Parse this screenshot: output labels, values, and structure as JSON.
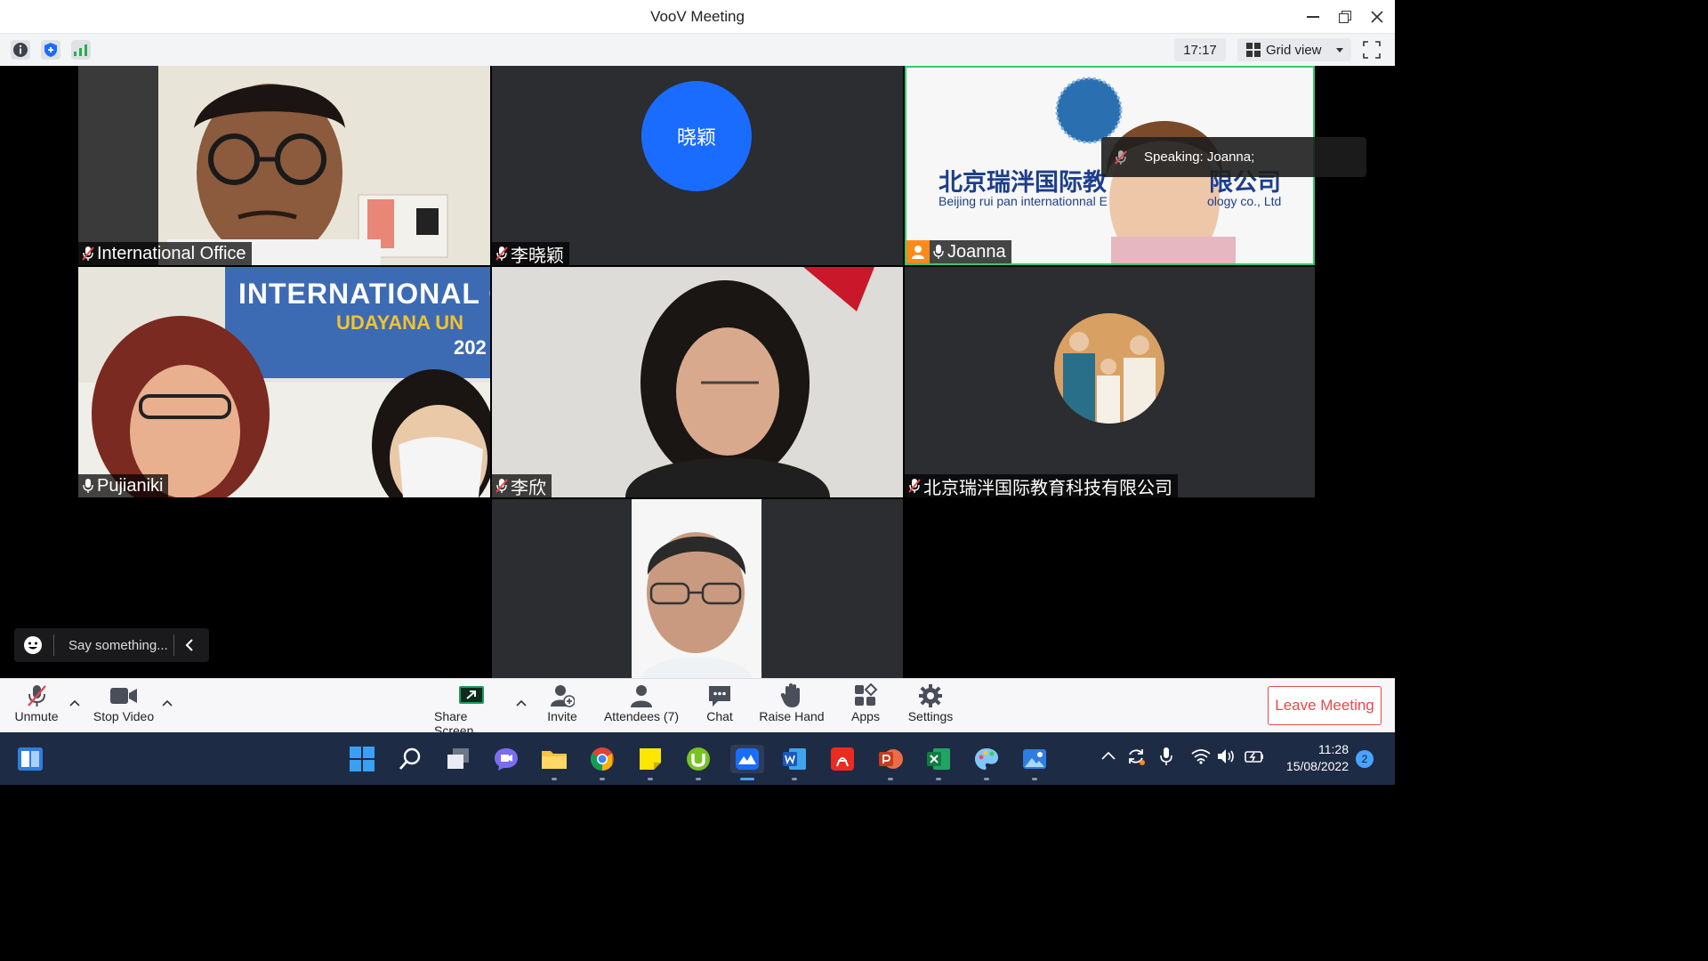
{
  "window": {
    "title": "VooV Meeting"
  },
  "toolbar": {
    "time": "17:17",
    "view_label": "Grid view"
  },
  "speaking_banner": "Speaking: Joanna;",
  "participants": {
    "international_office": "International Office",
    "li_xiaoying": "李晓颖",
    "li_xiaoying_avatar": "晓颖",
    "joanna": "Joanna",
    "pujianiki": "Pujianiki",
    "li_xin": "李欣",
    "company": "北京瑞泮国际教育科技有限公司"
  },
  "joanna_background": {
    "cn": "北京瑞泮国际教",
    "cn2": "限公司",
    "en": "Beijing rui pan internationnal E",
    "en2": "ology co., Ltd"
  },
  "pujianiki_banner": {
    "line1": "INTERNATIONAL CREDIT T",
    "line2": "UDAYANA UN",
    "line3": "202"
  },
  "chat": {
    "placeholder": "Say something..."
  },
  "controls": {
    "unmute": "Unmute",
    "stop_video": "Stop Video",
    "share_screen": "Share Screen",
    "invite": "Invite",
    "attendees": "Attendees (7)",
    "chat": "Chat",
    "raise_hand": "Raise Hand",
    "apps": "Apps",
    "settings": "Settings",
    "leave": "Leave Meeting"
  },
  "taskbar": {
    "time": "11:28",
    "date": "15/08/2022",
    "notifications": "2"
  },
  "colors": {
    "accent_blue": "#1a6cff",
    "leave_red": "#e34a4a",
    "joanna_border": "#2ecc71",
    "taskbar": "#1e2b44"
  }
}
